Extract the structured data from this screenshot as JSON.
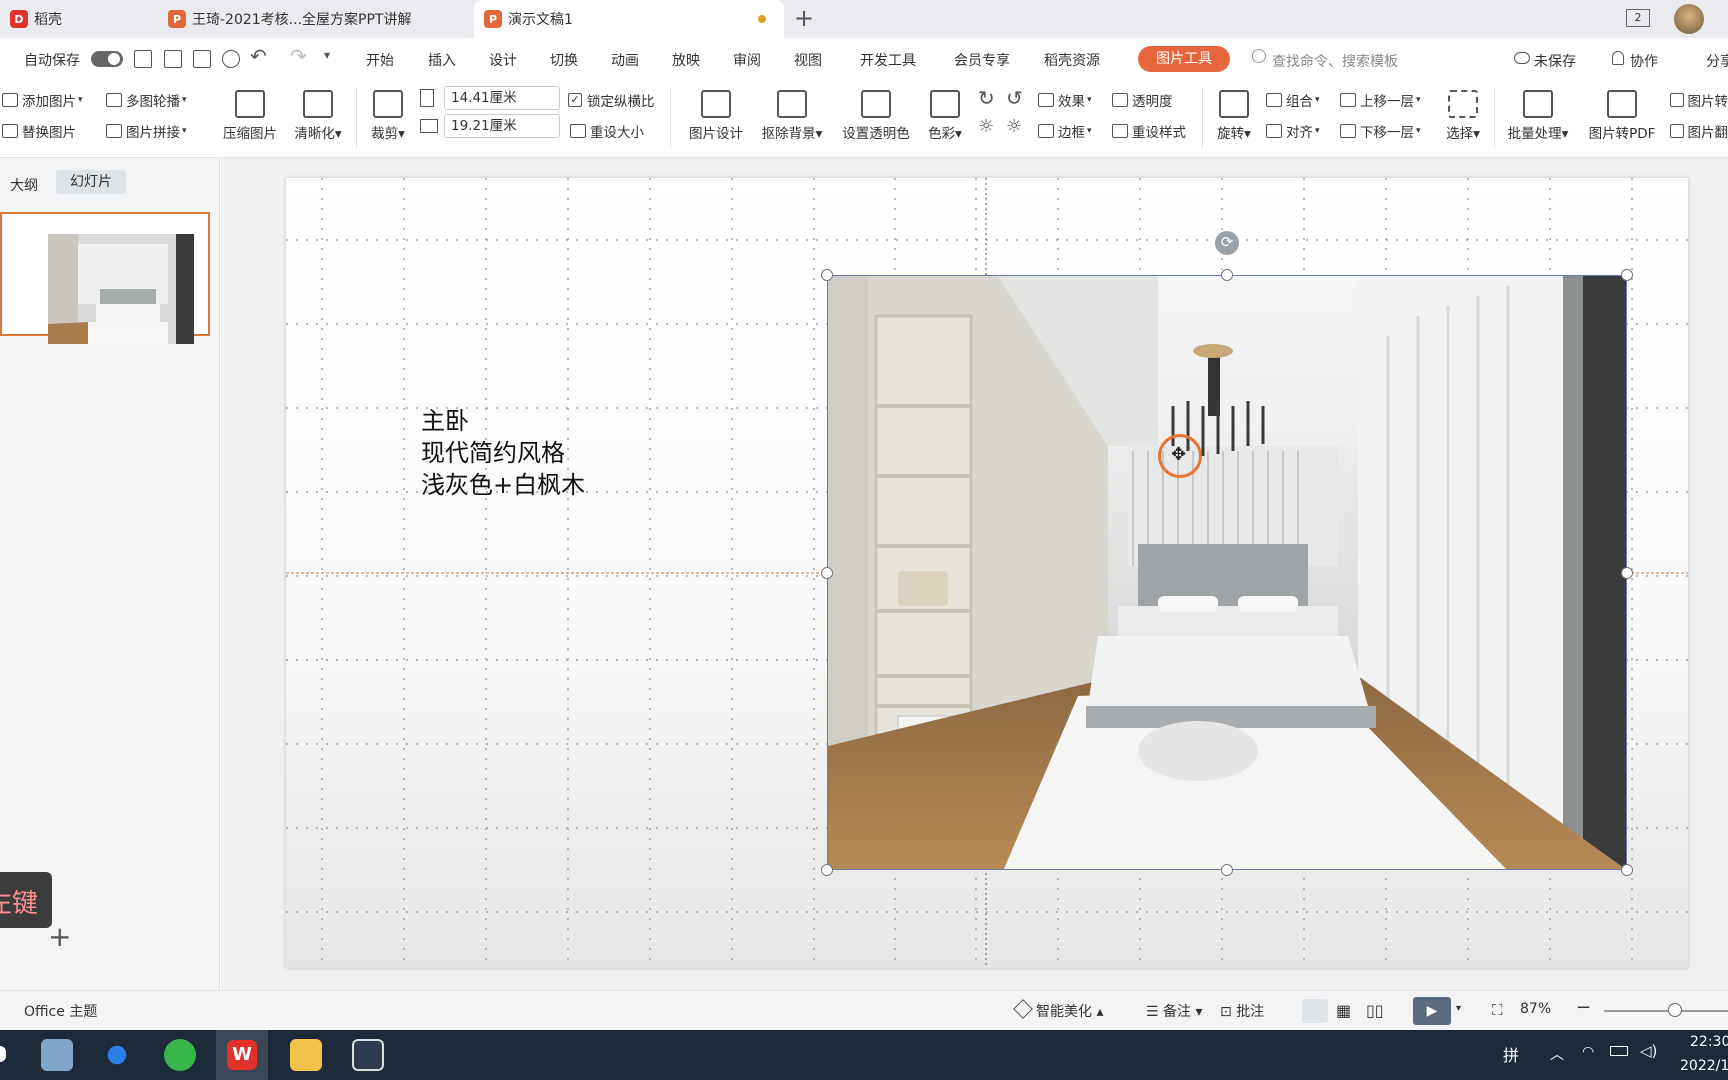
{
  "tabs": [
    {
      "label": "稻壳"
    },
    {
      "label": "王琦-2021考核...全屋方案PPT讲解"
    },
    {
      "label": "演示文稿1"
    }
  ],
  "tab_new": "+",
  "tab_count": "2",
  "menubar": {
    "autosave": "自动保存",
    "items": [
      "开始",
      "插入",
      "设计",
      "切换",
      "动画",
      "放映",
      "审阅",
      "视图",
      "开发工具",
      "会员专享",
      "稻壳资源",
      "图片工具"
    ],
    "search_placeholder": "查找命令、搜索模板",
    "unsaved": "未保存",
    "collab": "协作",
    "share": "分享"
  },
  "ribbon": {
    "add_image": "添加图片",
    "multi_carousel": "多图轮播",
    "replace_image": "替换图片",
    "image_stitch": "图片拼接",
    "compress": "压缩图片",
    "sharpen": "清晰化",
    "crop": "裁剪",
    "width": "14.41厘米",
    "height": "19.21厘米",
    "lock_ratio": "锁定纵横比",
    "reset_size": "重设大小",
    "image_design": "图片设计",
    "remove_bg": "抠除背景",
    "set_transparent": "设置透明色",
    "color": "色彩",
    "effects": "效果",
    "transparency": "透明度",
    "border": "边框",
    "reset_style": "重设样式",
    "rotate": "旋转",
    "group": "组合",
    "align": "对齐",
    "bring_forward": "上移一层",
    "send_backward": "下移一层",
    "select": "选择",
    "batch": "批量处理",
    "to_pdf": "图片转PDF",
    "img_to_text": "图片转",
    "img_text2": "图片翻"
  },
  "left_panel": {
    "tab_outline": "大纲",
    "tab_slides": "幻灯片",
    "add_slide": "+",
    "hint": "左键"
  },
  "slide": {
    "text_lines": [
      "主卧",
      "现代简约风格",
      "浅灰色+白枫木"
    ]
  },
  "status": {
    "theme": "Office 主题",
    "beautify": "智能美化",
    "notes": "备注",
    "comment": "批注",
    "zoom": "87%"
  },
  "taskbar": {
    "ime": "拼",
    "time": "22:30",
    "date": "2022/1"
  },
  "colors": {
    "accent": "#e8663d",
    "tab_bar": "#e9ebee",
    "taskbar": "#1c2a3a"
  }
}
